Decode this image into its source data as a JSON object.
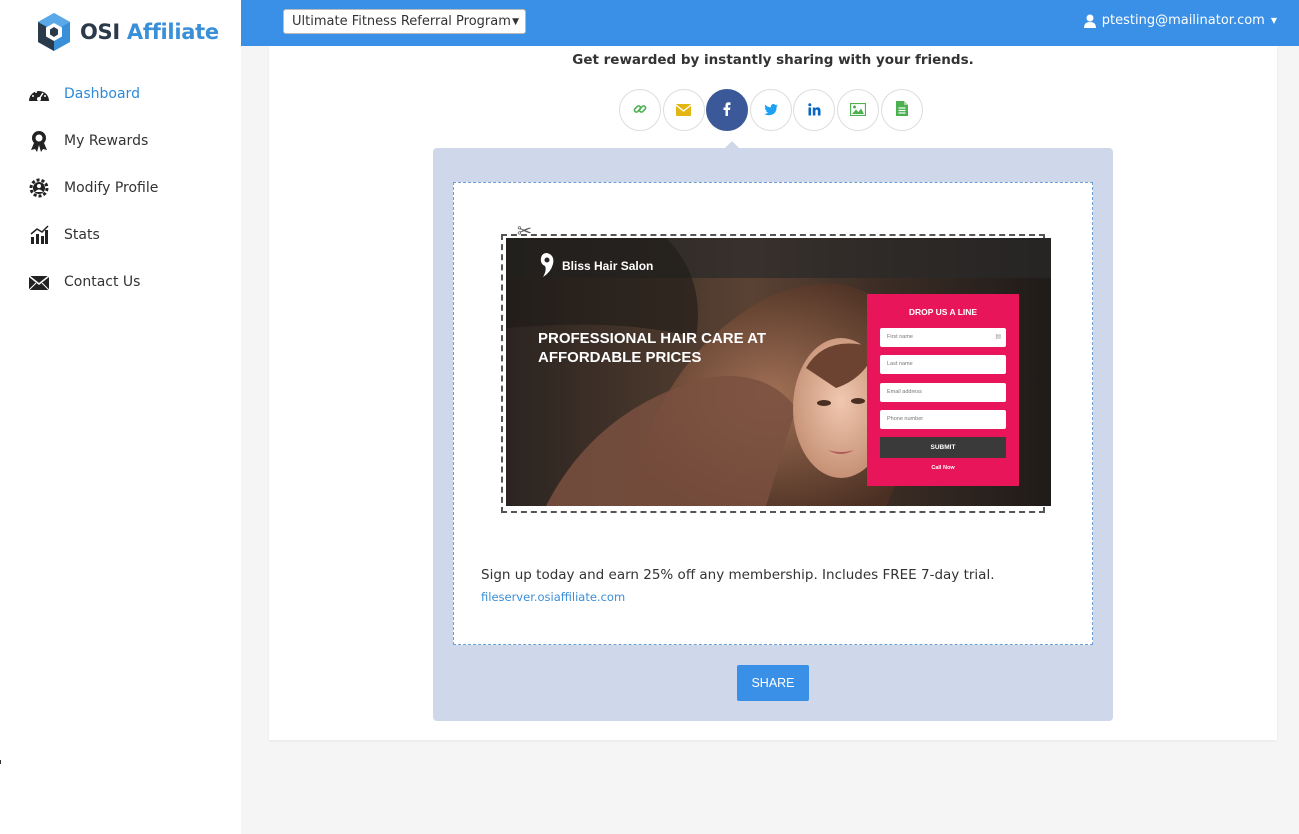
{
  "brand": {
    "name_part1": "OSI",
    "name_part2": "Affiliate"
  },
  "sidebar": {
    "items": [
      {
        "label": "Dashboard",
        "icon": "dashboard-gauge-icon",
        "active": true
      },
      {
        "label": "My Rewards",
        "icon": "award-ribbon-icon",
        "active": false
      },
      {
        "label": "Modify Profile",
        "icon": "gear-user-icon",
        "active": false
      },
      {
        "label": "Stats",
        "icon": "bar-chart-icon",
        "active": false
      },
      {
        "label": "Contact Us",
        "icon": "envelope-icon",
        "active": false
      }
    ]
  },
  "topbar": {
    "program_selected": "Ultimate Fitness Referral Program",
    "user_email": "ptesting@mailinator.com"
  },
  "main": {
    "headline": "Get rewarded by instantly sharing with your friends.",
    "share_options": [
      {
        "name": "link",
        "icon": "link-icon",
        "color": "#4caf50"
      },
      {
        "name": "email",
        "icon": "envelope-icon",
        "color": "#e2b714"
      },
      {
        "name": "facebook",
        "icon": "facebook-icon",
        "color": "#ffffff",
        "active": true
      },
      {
        "name": "twitter",
        "icon": "twitter-icon",
        "color": "#1da1f2"
      },
      {
        "name": "linkedin",
        "icon": "linkedin-icon",
        "color": "#0a66c2"
      },
      {
        "name": "image",
        "icon": "image-icon",
        "color": "#4caf50"
      },
      {
        "name": "document",
        "icon": "document-icon",
        "color": "#4caf50"
      }
    ],
    "banner": {
      "salon_name": "Bliss Hair Salon",
      "hero_title": "PROFESSIONAL HAIR CARE AT AFFORDABLE PRICES",
      "form_title": "DROP US A LINE",
      "fields": [
        "First name",
        "Last name",
        "Email address",
        "Phone number"
      ],
      "submit_label": "SUBMIT",
      "call_label": "Call Now"
    },
    "message": "Sign up today and earn 25% off any membership. Includes FREE 7-day trial.",
    "link_text": "fileserver.osiaffiliate.com",
    "share_button_label": "SHARE"
  }
}
